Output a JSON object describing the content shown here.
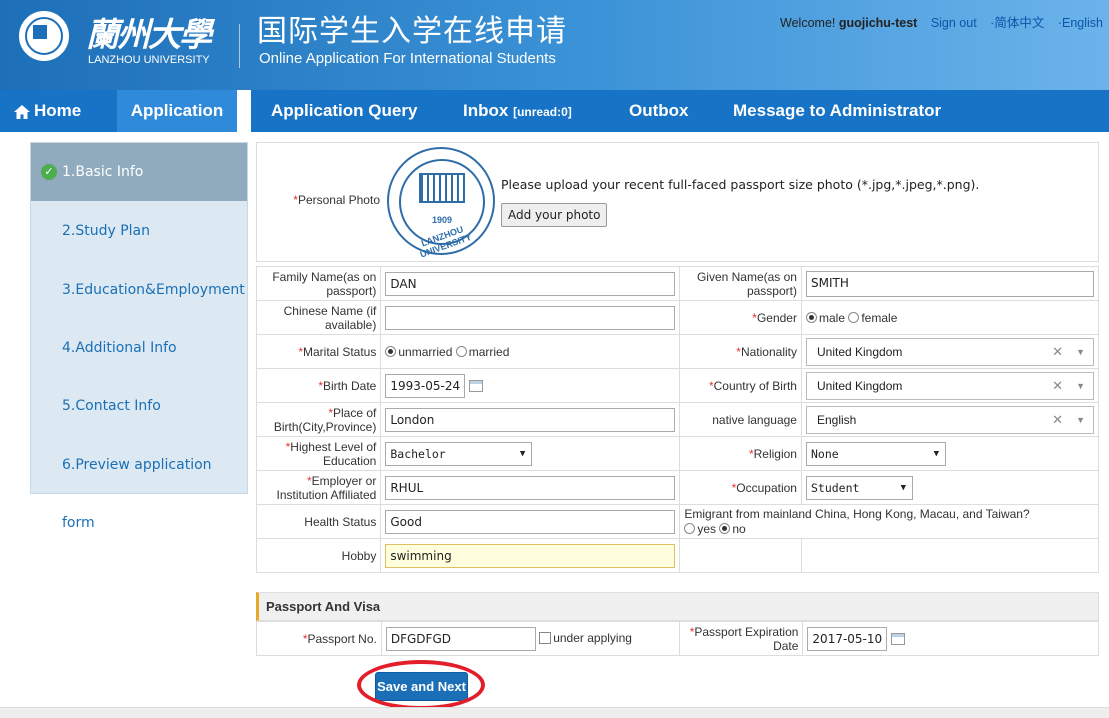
{
  "header": {
    "logo_cn": "蘭州大學",
    "logo_en": "LANZHOU UNIVERSITY",
    "title_cn": "国际学生入学在线申请",
    "title_en": "Online Application For International Students",
    "welcome": "Welcome!",
    "username": "guojichu-test",
    "signout": "Sign out",
    "lang_cn": "·简体中文",
    "lang_en": "·English"
  },
  "nav": {
    "home": "Home",
    "application": "Application",
    "query": "Application Query",
    "inbox": "Inbox",
    "unread": "[unread:0]",
    "outbox": "Outbox",
    "message": "Message to Administrator"
  },
  "sidebar": {
    "items": [
      {
        "label": "1.Basic Info"
      },
      {
        "label": "2.Study Plan"
      },
      {
        "label": "3.Education&Employment"
      },
      {
        "label": "4.Additional Info"
      },
      {
        "label": "5.Contact Info"
      },
      {
        "label": "6.Preview application form"
      }
    ]
  },
  "photo": {
    "label": "Personal Photo",
    "hint": "Please upload your recent full-faced passport size photo (*.jpg,*.jpeg,*.png).",
    "button": "Add your photo",
    "seal_year": "1909",
    "seal_text": "LANZHOU UNIVERSITY"
  },
  "form": {
    "family_name_label": "Family Name(as on passport)",
    "family_name": "DAN",
    "given_name_label": "Given Name(as on passport)",
    "given_name": "SMITH",
    "chinese_name_label": "Chinese Name (if available)",
    "chinese_name": "",
    "gender_label": "Gender",
    "gender_male": "male",
    "gender_female": "female",
    "marital_label": "Marital Status",
    "marital_unmarried": "unmarried",
    "marital_married": "married",
    "nationality_label": "Nationality",
    "nationality": "United Kingdom",
    "birth_date_label": "Birth Date",
    "birth_date": "1993-05-24",
    "country_birth_label": "Country of Birth",
    "country_birth": "United Kingdom",
    "place_birth_label": "Place of Birth(City,Province)",
    "place_birth": "London",
    "native_lang_label": "native language",
    "native_lang": "English",
    "education_label": "Highest Level of Education",
    "education": "Bachelor",
    "religion_label": "Religion",
    "religion": "None",
    "employer_label": "Employer or Institution Affiliated",
    "employer": "RHUL",
    "occupation_label": "Occupation",
    "occupation": "Student",
    "health_label": "Health Status",
    "health": "Good",
    "emigrant_label": "Emigrant from mainland China, Hong Kong, Macau, and Taiwan?",
    "emigrant_yes": "yes",
    "emigrant_no": "no",
    "hobby_label": "Hobby",
    "hobby": "swimming"
  },
  "passport": {
    "section_title": "Passport And Visa",
    "no_label": "Passport No.",
    "no": "DFGDFGD",
    "under_applying": "under applying",
    "expiry_label": "Passport Expiration Date",
    "expiry": "2017-05-10"
  },
  "actions": {
    "save_next": "Save and Next"
  },
  "colors": {
    "nav_bg": "#1773c6",
    "accent_red": "#e21e2a",
    "required": "#e53333"
  }
}
